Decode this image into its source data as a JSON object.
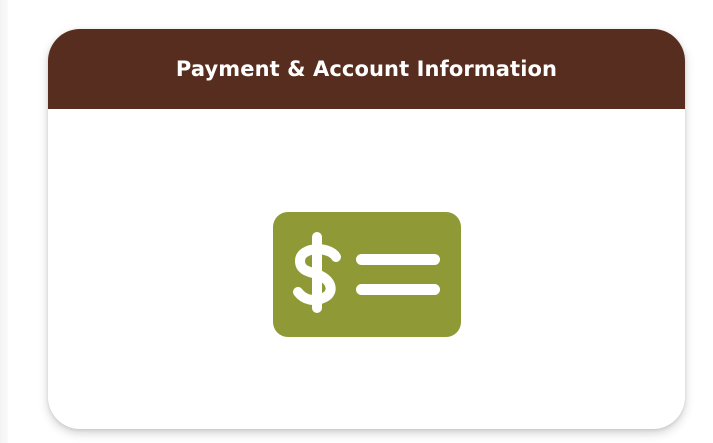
{
  "card": {
    "title": "Payment & Account Information",
    "icon": "payment-card-icon",
    "colors": {
      "header_bg": "#572d1f",
      "header_text": "#ffffff",
      "icon_bg": "#8f9a36",
      "icon_fg": "#ffffff"
    }
  }
}
